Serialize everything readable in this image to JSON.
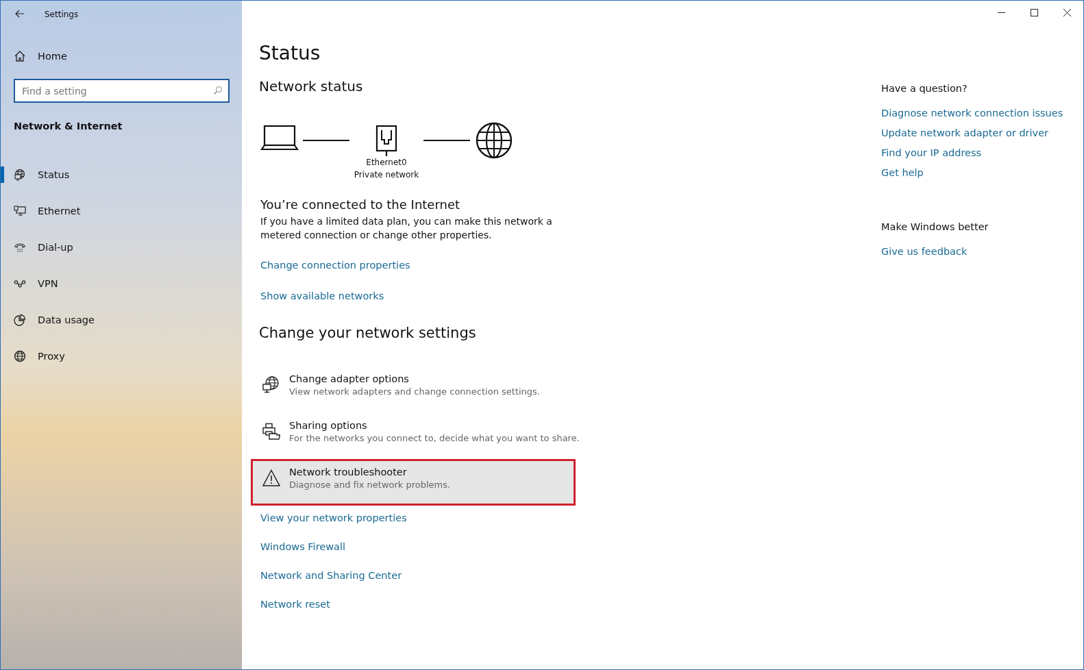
{
  "window": {
    "title": "Settings"
  },
  "sidebar": {
    "home": "Home",
    "search": {
      "placeholder": "Find a setting"
    },
    "section": "Network & Internet",
    "items": [
      {
        "label": "Status",
        "selected": true
      },
      {
        "label": "Ethernet",
        "selected": false
      },
      {
        "label": "Dial-up",
        "selected": false
      },
      {
        "label": "VPN",
        "selected": false
      },
      {
        "label": "Data usage",
        "selected": false
      },
      {
        "label": "Proxy",
        "selected": false
      }
    ]
  },
  "main": {
    "title": "Status",
    "network_status": {
      "heading": "Network status",
      "adapter": "Ethernet0",
      "network_type": "Private network"
    },
    "connection": {
      "heading": "You’re connected to the Internet",
      "text": "If you have a limited data plan, you can make this network a metered connection or change other properties.",
      "links": [
        "Change connection properties",
        "Show available networks"
      ]
    },
    "change_heading": "Change your network settings",
    "options": [
      {
        "title": "Change adapter options",
        "description": "View network adapters and change connection settings.",
        "highlighted": false
      },
      {
        "title": "Sharing options",
        "description": "For the networks you connect to, decide what you want to share.",
        "highlighted": false
      },
      {
        "title": "Network troubleshooter",
        "description": "Diagnose and fix network problems.",
        "highlighted": true
      }
    ],
    "links": [
      "View your network properties",
      "Windows Firewall",
      "Network and Sharing Center",
      "Network reset"
    ]
  },
  "aside": {
    "question_heading": "Have a question?",
    "question_links": [
      "Diagnose network connection issues",
      "Update network adapter or driver",
      "Find your IP address",
      "Get help"
    ],
    "better_heading": "Make Windows better",
    "better_links": [
      "Give us feedback"
    ]
  }
}
